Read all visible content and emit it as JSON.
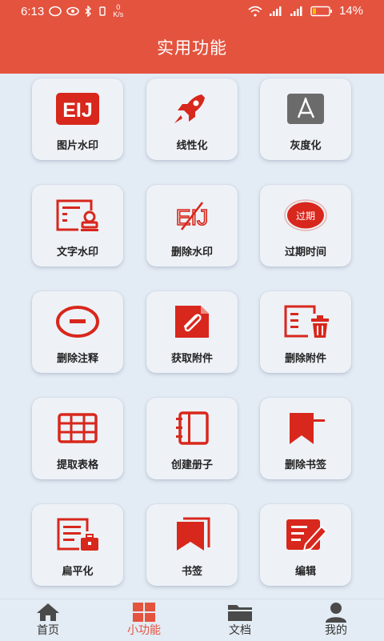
{
  "status": {
    "time": "6:13",
    "battery": "14%",
    "net_speed": "K/s",
    "net_speed_value": "0"
  },
  "header": {
    "title": "实用功能"
  },
  "features": [
    {
      "label": "图片水印",
      "icon": "image-watermark-icon"
    },
    {
      "label": "线性化",
      "icon": "rocket-icon"
    },
    {
      "label": "灰度化",
      "icon": "pdf-gray-icon"
    },
    {
      "label": "文字水印",
      "icon": "text-watermark-icon"
    },
    {
      "label": "删除水印",
      "icon": "remove-watermark-icon"
    },
    {
      "label": "过期时间",
      "icon": "expire-stamp-icon",
      "icon_text": "过期"
    },
    {
      "label": "删除注释",
      "icon": "minus-circle-icon"
    },
    {
      "label": "获取附件",
      "icon": "paperclip-icon"
    },
    {
      "label": "删除附件",
      "icon": "delete-attachment-icon"
    },
    {
      "label": "提取表格",
      "icon": "table-icon"
    },
    {
      "label": "创建册子",
      "icon": "booklet-icon"
    },
    {
      "label": "删除书签",
      "icon": "remove-bookmark-icon"
    },
    {
      "label": "扁平化",
      "icon": "flatten-icon"
    },
    {
      "label": "书签",
      "icon": "bookmark-icon"
    },
    {
      "label": "编辑",
      "icon": "edit-icon"
    }
  ],
  "tabs": [
    {
      "label": "首页",
      "icon": "home-icon"
    },
    {
      "label": "小功能",
      "icon": "grid-icon",
      "active": true
    },
    {
      "label": "文档",
      "icon": "folder-icon"
    },
    {
      "label": "我的",
      "icon": "user-icon"
    }
  ],
  "colors": {
    "accent": "#e4533e",
    "icon_red": "#d8271c",
    "background": "#e3ebf4"
  }
}
